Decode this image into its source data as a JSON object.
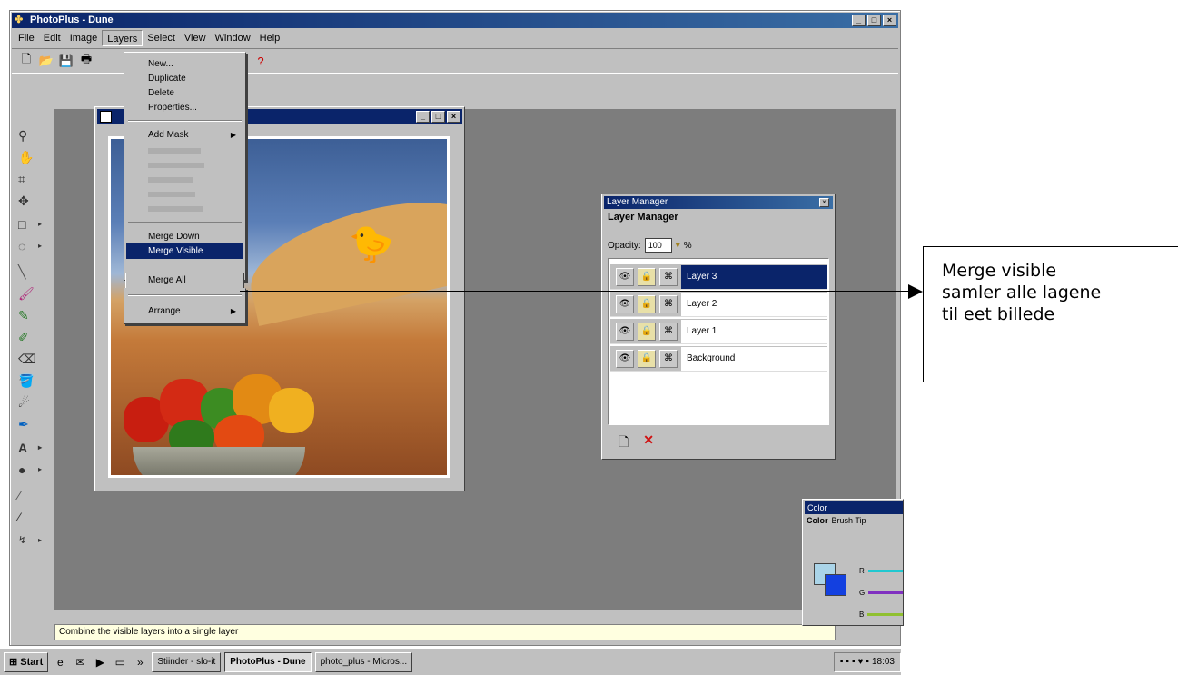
{
  "app": {
    "title": "PhotoPlus - Dune"
  },
  "menubar": [
    "File",
    "Edit",
    "Image",
    "Layers",
    "Select",
    "View",
    "Window",
    "Help"
  ],
  "layers_menu": {
    "new": "New...",
    "duplicate": "Duplicate",
    "delete": "Delete",
    "properties": "Properties...",
    "add_mask": "Add Mask",
    "merge_down": "Merge Down",
    "merge_visible": "Merge Visible",
    "merge_all": "Merge All",
    "arrange": "Arrange"
  },
  "layer_manager": {
    "title": "Layer Manager",
    "tab": "Layer Manager",
    "opacity_label": "Opacity:",
    "opacity_value": "100",
    "layers": [
      "Layer 3",
      "Layer 2",
      "Layer 1",
      "Background"
    ]
  },
  "color_panel": {
    "title": "Color",
    "tab_color": "Color",
    "tab_brush": "Brush Tip",
    "channel_r": "R",
    "channel_g": "G",
    "channel_b": "B"
  },
  "statusbar": {
    "text": "Combine the visible layers into a single layer"
  },
  "taskbar": {
    "start": "Start",
    "task1": "Stiinder - slo-it",
    "task2": "PhotoPlus - Dune",
    "task3": "photo_plus - Micros...",
    "time": "18:03"
  },
  "annotation": {
    "line1": "Merge visible",
    "line2": "samler alle lagene",
    "line3": "til eet billede"
  }
}
